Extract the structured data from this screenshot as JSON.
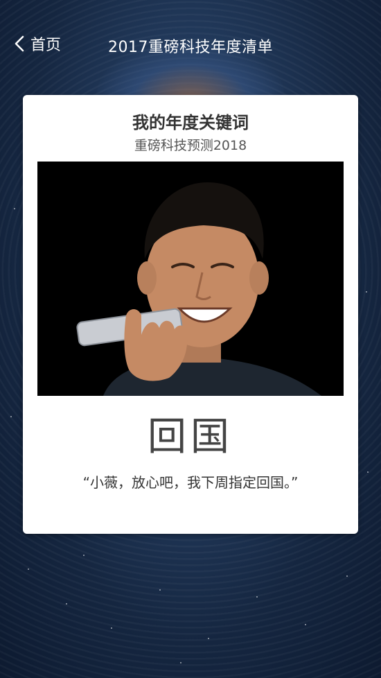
{
  "header": {
    "back_label": "首页",
    "title": "2017重磅科技年度清单"
  },
  "card": {
    "title": "我的年度关键词",
    "subtitle": "重磅科技预测2018",
    "keyword": "回国",
    "quote": "“小薇，放心吧，我下周指定回国。”"
  },
  "colors": {
    "background": "#1b2f4f",
    "card": "#ffffff",
    "text": "#333333"
  }
}
